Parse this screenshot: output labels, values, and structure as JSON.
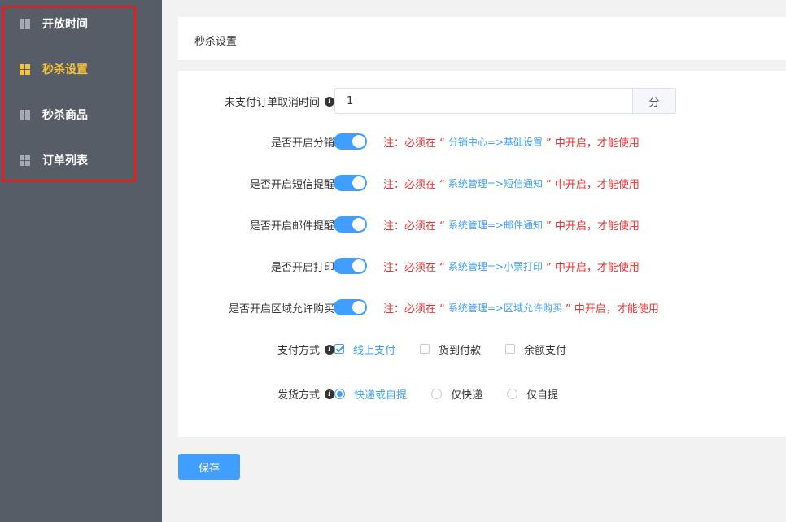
{
  "sidebar": {
    "items": [
      {
        "label": "开放时间",
        "active": false
      },
      {
        "label": "秒杀设置",
        "active": true
      },
      {
        "label": "秒杀商品",
        "active": false
      },
      {
        "label": "订单列表",
        "active": false
      }
    ]
  },
  "header": {
    "title": "秒杀设置"
  },
  "form": {
    "cancel_time": {
      "label": "未支付订单取消时间",
      "value": "1",
      "unit": "分"
    },
    "distribution": {
      "label": "是否开启分销",
      "enabled": true,
      "note_prefix": "注：必须在 “",
      "note_path": "分销中心=>基础设置",
      "note_suffix": "” 中开启，才能使用"
    },
    "sms": {
      "label": "是否开启短信提醒",
      "enabled": true,
      "note_prefix": "注：必须在 “",
      "note_path": "系统管理=>短信通知",
      "note_suffix": "” 中开启，才能使用"
    },
    "email": {
      "label": "是否开启邮件提醒",
      "enabled": true,
      "note_prefix": "注：必须在 “",
      "note_path": "系统管理=>邮件通知",
      "note_suffix": "” 中开启，才能使用"
    },
    "print": {
      "label": "是否开启打印",
      "enabled": true,
      "note_prefix": "注：必须在 “",
      "note_path": "系统管理=>小票打印",
      "note_suffix": "” 中开启，才能使用"
    },
    "region": {
      "label": "是否开启区域允许购买",
      "enabled": true,
      "note_prefix": "注：必须在 “",
      "note_path": "系统管理=>区域允许购买",
      "note_suffix": "” 中开启，才能使用"
    },
    "payment": {
      "label": "支付方式",
      "options": [
        {
          "label": "线上支付",
          "checked": true
        },
        {
          "label": "货到付款",
          "checked": false
        },
        {
          "label": "余额支付",
          "checked": false
        }
      ]
    },
    "delivery": {
      "label": "发货方式",
      "options": [
        {
          "label": "快递或自提",
          "checked": true
        },
        {
          "label": "仅快递",
          "checked": false
        },
        {
          "label": "仅自提",
          "checked": false
        }
      ]
    }
  },
  "actions": {
    "save_label": "保存"
  },
  "colors": {
    "primary": "#409eff",
    "sidebar_bg": "#565d66",
    "active_menu": "#f7c440",
    "note_red": "#f03030"
  }
}
